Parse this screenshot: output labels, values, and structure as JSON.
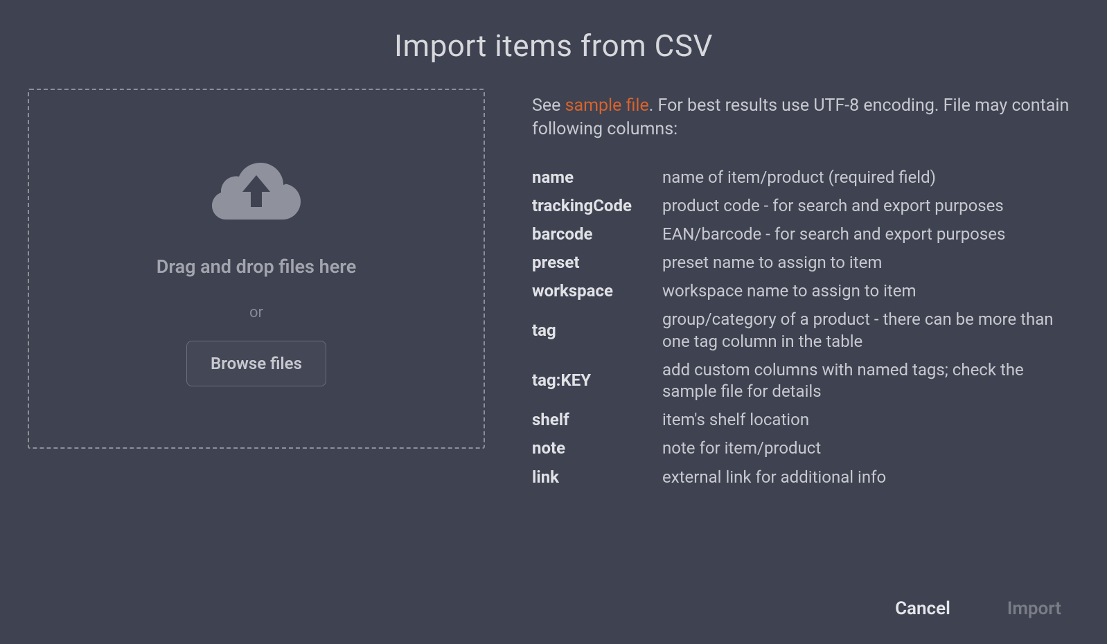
{
  "title": "Import items from CSV",
  "dropzone": {
    "drag_text": "Drag and drop files here",
    "or_text": "or",
    "browse_label": "Browse files"
  },
  "info": {
    "intro_prefix": "See ",
    "sample_link": "sample file",
    "intro_suffix": ". For best results use UTF-8 encoding. File may contain following columns:"
  },
  "columns": [
    {
      "name": "name",
      "desc": "name of item/product (required field)"
    },
    {
      "name": "trackingCode",
      "desc": "product code - for search and export purposes"
    },
    {
      "name": "barcode",
      "desc": "EAN/barcode - for search and export purposes"
    },
    {
      "name": "preset",
      "desc": "preset name to assign to item"
    },
    {
      "name": "workspace",
      "desc": "workspace name to assign to item"
    },
    {
      "name": "tag",
      "desc": "group/category of a product - there can be more than one tag column in the table"
    },
    {
      "name": "tag:KEY",
      "desc": "add custom columns with named tags; check the sample file for details"
    },
    {
      "name": "shelf",
      "desc": "item's shelf location"
    },
    {
      "name": "note",
      "desc": "note for item/product"
    },
    {
      "name": "link",
      "desc": "external link for additional info"
    }
  ],
  "buttons": {
    "cancel": "Cancel",
    "import": "Import"
  }
}
